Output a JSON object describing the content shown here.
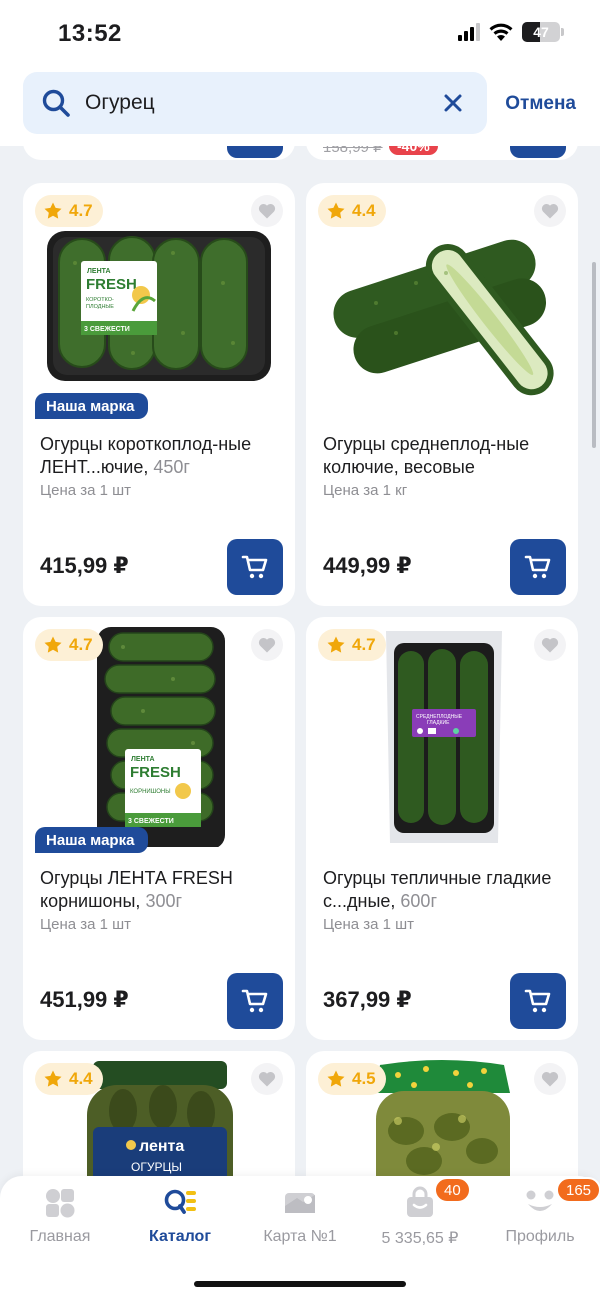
{
  "status": {
    "time": "13:52",
    "battery": "47"
  },
  "search": {
    "query": "Огурец",
    "cancel_label": "Отмена"
  },
  "partial_top": {
    "old_price": "158,99 ₽",
    "discount": "-40%"
  },
  "products": [
    {
      "rating": "4.7",
      "badge": "Наша марка",
      "name": "Огурцы коротоплод-ные ЛЕНТ...ючие,",
      "name_line": "Огурцы короткоплод-ные ЛЕНТ...ючие, ",
      "weight": "450г",
      "unit": "Цена за 1 шт",
      "price": "415,99 ₽",
      "pack_brand": "ЛЕНТА",
      "pack_title": "FRESH",
      "pack_sub": "КОРОТКО-ПЛОДНЫЕ",
      "pack_foot": "3 СВЕЖЕСТИ"
    },
    {
      "rating": "4.4",
      "badge": "",
      "name_line": "Огурцы среднеплод-ные колючие, весовые",
      "weight": "",
      "unit": "Цена за 1 кг",
      "price": "449,99 ₽"
    },
    {
      "rating": "4.7",
      "badge": "Наша марка",
      "name_line": "Огурцы ЛЕНТА FRESH корнишоны, ",
      "weight": "300г",
      "unit": "Цена за 1 шт",
      "price": "451,99 ₽",
      "pack_brand": "ЛЕНТА",
      "pack_title": "FRESH",
      "pack_sub": "КОРНИШОНЫ",
      "pack_foot": "3 СВЕЖЕСТИ"
    },
    {
      "rating": "4.7",
      "badge": "",
      "name_line": "Огурцы тепличные гладкие с...дные, ",
      "weight": "600г",
      "unit": "Цена за 1 шт",
      "price": "367,99 ₽",
      "pack_sub": "СРЕДНЕПЛОДНЫЕ ГЛАДКИЕ"
    },
    {
      "rating": "4.4",
      "jar_brand": "лента",
      "jar_text": "ОГУРЦЫ"
    },
    {
      "rating": "4.5"
    }
  ],
  "tabs": [
    {
      "label": "Главная",
      "icon": "home-icon"
    },
    {
      "label": "Каталог",
      "icon": "catalog-icon"
    },
    {
      "label": "Карта №1",
      "icon": "loyalty-card-icon"
    },
    {
      "label": "5 335,65 ₽",
      "icon": "cart-bag-icon",
      "badge": "40"
    },
    {
      "label": "Профиль",
      "icon": "profile-icon",
      "badge": "165"
    }
  ],
  "colors": {
    "brand_blue": "#1f4b9a",
    "rating_yellow": "#f0a70a",
    "discount_red": "#e8434b",
    "badge_orange": "#f26b1d",
    "search_bg": "#e8f1fc"
  }
}
